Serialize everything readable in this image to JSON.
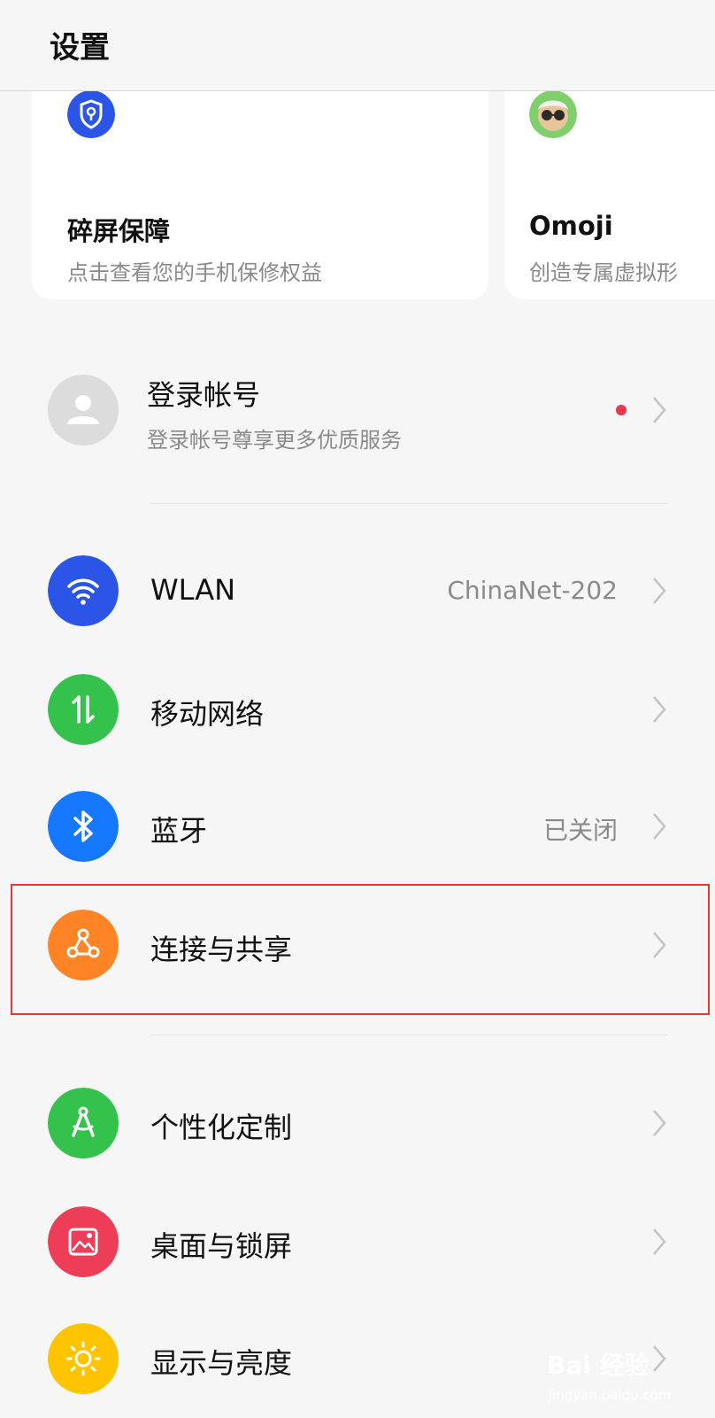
{
  "header": {
    "title": "设置"
  },
  "cards": [
    {
      "title": "碎屏保障",
      "subtitle": "点击查看您的手机保修权益",
      "icon": "shield-key-icon"
    },
    {
      "title": "Omoji",
      "subtitle": "创造专属虚拟形",
      "icon": "omoji-avatar-icon"
    }
  ],
  "account": {
    "title": "登录帐号",
    "subtitle": "登录帐号尊享更多优质服务"
  },
  "settings": [
    {
      "label": "WLAN",
      "value": "ChinaNet-202",
      "icon": "wifi-icon",
      "color": "#2b55e6"
    },
    {
      "label": "移动网络",
      "value": "",
      "icon": "mobile-data-icon",
      "color": "#34c24c"
    },
    {
      "label": "蓝牙",
      "value": "已关闭",
      "icon": "bluetooth-icon",
      "color": "#1677ff"
    },
    {
      "label": "连接与共享",
      "value": "",
      "icon": "share-connect-icon",
      "color": "#ff8426"
    },
    {
      "label": "个性化定制",
      "value": "",
      "icon": "compass-icon",
      "color": "#34c24c"
    },
    {
      "label": "桌面与锁屏",
      "value": "",
      "icon": "picture-icon",
      "color": "#ee3d57"
    },
    {
      "label": "显示与亮度",
      "value": "",
      "icon": "sun-icon",
      "color": "#ffc400"
    }
  ],
  "watermark": {
    "main": "Bai 经验",
    "sub": "jingyan.baidu.com"
  }
}
